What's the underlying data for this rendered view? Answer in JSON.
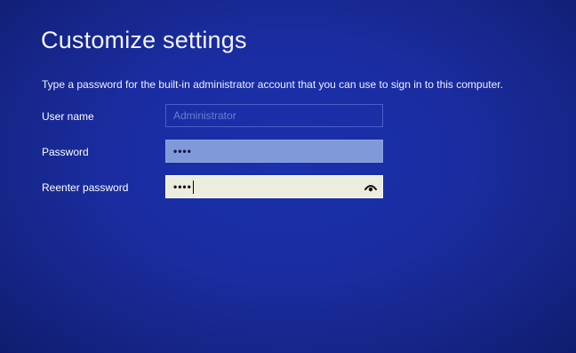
{
  "page": {
    "title": "Customize settings",
    "instruction": "Type a password for the built-in administrator account that you can use to sign in to this computer."
  },
  "form": {
    "username": {
      "label": "User name",
      "placeholder": "Administrator",
      "value": ""
    },
    "password": {
      "label": "Password",
      "masked_value": "••••"
    },
    "reenter_password": {
      "label": "Reenter password",
      "masked_value": "••••",
      "reveal_icon": "eye-icon"
    }
  },
  "colors": {
    "background": "#1a2c9f",
    "password_field": "#7f99d9",
    "reenter_field": "#ececdf"
  }
}
